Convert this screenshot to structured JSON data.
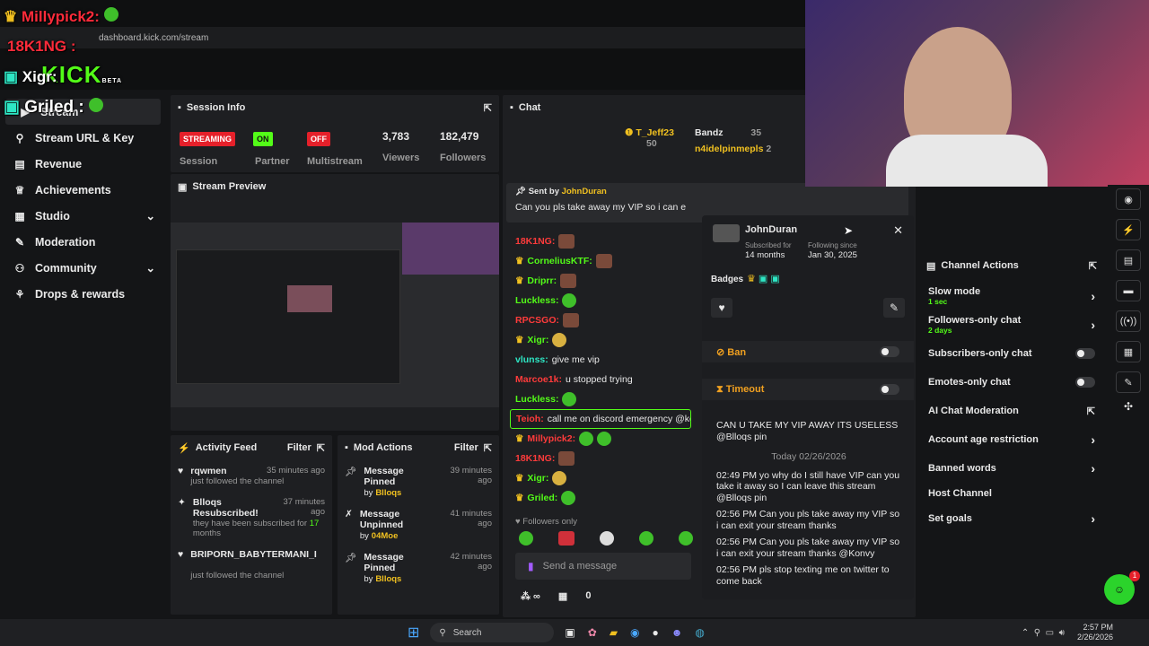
{
  "overlay": {
    "users": [
      {
        "name": "Millypick2",
        "suffix": ":"
      },
      {
        "name": "18K1NG",
        "suffix": ":"
      },
      {
        "name": "Xigr",
        "suffix": ":"
      },
      {
        "name": "Griled",
        "suffix": ":"
      }
    ],
    "logo": "KICK",
    "logo_sub": "BETA"
  },
  "browser": {
    "url": "dashboard.kick.com/stream"
  },
  "sidebar": {
    "items": [
      {
        "label": "Stream",
        "icon": "stream-icon"
      },
      {
        "label": "Stream URL & Key",
        "icon": "key-icon"
      },
      {
        "label": "Revenue",
        "icon": "revenue-icon"
      },
      {
        "label": "Achievements",
        "icon": "trophy-icon"
      },
      {
        "label": "Studio",
        "icon": "studio-icon"
      },
      {
        "label": "Moderation",
        "icon": "wrench-icon"
      },
      {
        "label": "Community",
        "icon": "community-icon"
      },
      {
        "label": "Drops & rewards",
        "icon": "gift-icon"
      }
    ]
  },
  "session": {
    "title": "Session Info",
    "streaming": "STREAMING",
    "on": "ON",
    "off": "OFF",
    "viewers": "3,783",
    "followers": "182,479",
    "labels": {
      "session": "Session",
      "partner": "Partner",
      "multistream": "Multistream",
      "viewers": "Viewers",
      "followers": "Followers"
    }
  },
  "preview": {
    "title": "Stream Preview"
  },
  "activity": {
    "title": "Activity Feed",
    "filter": "Filter",
    "items": [
      {
        "name": "rqwmen",
        "time": "35 minutes ago",
        "desc": "just followed the channel"
      },
      {
        "name": "Blloqs Resubscribed!",
        "time": "37 minutes ago",
        "desc": "they have been subscribed for",
        "months": "17",
        "months_suffix": "months"
      },
      {
        "name": "BRIPORN_BABYTERMANI_I",
        "time": "",
        "desc": "just followed the channel"
      }
    ]
  },
  "mod": {
    "title": "Mod Actions",
    "filter": "Filter",
    "items": [
      {
        "action": "Message Pinned",
        "by": "by",
        "user": "Blloqs",
        "time": "39 minutes ago"
      },
      {
        "action": "Message Unpinned",
        "by": "by",
        "user": "04Moe",
        "time": "41 minutes ago"
      },
      {
        "action": "Message Pinned",
        "by": "by",
        "user": "Blloqs",
        "time": "42 minutes ago"
      }
    ]
  },
  "chat": {
    "title": "Chat",
    "top": [
      {
        "name": "T_Jeff23",
        "count": "50"
      },
      {
        "name": "Bandz",
        "count": "35"
      },
      {
        "name": "n4idelpinmepls",
        "count": "2"
      }
    ],
    "pinned": {
      "sent_by": "Sent by",
      "user": "JohnDuran",
      "text": "Can you pls take away my VIP so i can e"
    },
    "messages": [
      {
        "user": "18K1NG:",
        "text": "",
        "color": "#ff3b3b"
      },
      {
        "user": "CorneliusKTF:",
        "text": "",
        "color": "#53fc18"
      },
      {
        "user": "Driprr:",
        "text": "",
        "color": "#53fc18"
      },
      {
        "user": "Luckless:",
        "text": "",
        "color": "#53fc18"
      },
      {
        "user": "RPCSGO:",
        "text": "",
        "color": "#ff3b3b"
      },
      {
        "user": "Xigr:",
        "text": "",
        "color": "#53fc18"
      },
      {
        "user": "vlunss:",
        "text": "give me vip",
        "color": "#2ee6c4"
      },
      {
        "user": "Marcoe1k:",
        "text": "u stopped trying",
        "color": "#ff3b3b"
      },
      {
        "user": "Luckless:",
        "text": "",
        "color": "#53fc18"
      },
      {
        "user": "Teioh:",
        "text": "call me on discord emergency @kon",
        "color": "#ff3b3b"
      },
      {
        "user": "Millypick2:",
        "text": "",
        "color": "#ff3b3b"
      },
      {
        "user": "18K1NG:",
        "text": "",
        "color": "#ff3b3b"
      },
      {
        "user": "Xigr:",
        "text": "",
        "color": "#53fc18"
      },
      {
        "user": "Griled:",
        "text": "",
        "color": "#53fc18"
      }
    ],
    "followers_only": "Followers only",
    "placeholder": "Send a message",
    "bottom_count": "0"
  },
  "user_card": {
    "name": "JohnDuran",
    "sub_label": "Subscribed for",
    "sub_value": "14 months",
    "follow_label": "Following since",
    "follow_value": "Jan 30, 2025",
    "badges_label": "Badges",
    "ban": "Ban",
    "timeout": "Timeout",
    "history": [
      {
        "text": "CAN U TAKE MY VIP AWAY ITS USELESS @Blloqs pin"
      },
      {
        "text": "Today 02/26/2026"
      },
      {
        "text": "02:49 PM yo why do I still have VIP can you take it away so I can leave this stream @Blloqs pin"
      },
      {
        "text": "02:56 PM Can you pls take away my VIP so i can exit your stream thanks"
      },
      {
        "text": "02:56 PM Can you pls take away my VIP so i can exit your stream thanks @Konvy"
      },
      {
        "text": "02:56 PM pls stop texting me on twitter to come back"
      }
    ]
  },
  "channel_actions": {
    "title": "Channel Actions",
    "items": [
      {
        "label": "Slow mode",
        "sub": "1 sec",
        "type": "chev"
      },
      {
        "label": "Followers-only chat",
        "sub": "2 days",
        "type": "chev"
      },
      {
        "label": "Subscribers-only chat",
        "sub": "",
        "type": "toggle"
      },
      {
        "label": "Emotes-only chat",
        "sub": "",
        "type": "toggle"
      },
      {
        "label": "AI Chat Moderation",
        "sub": "",
        "type": "ext"
      },
      {
        "label": "Account age restriction",
        "sub": "",
        "type": "chev"
      },
      {
        "label": "Banned words",
        "sub": "",
        "type": "chev"
      },
      {
        "label": "Host Channel",
        "sub": "",
        "type": "none"
      },
      {
        "label": "Set goals",
        "sub": "",
        "type": "chev"
      }
    ]
  },
  "taskbar": {
    "search": "Search",
    "time": "2:57 PM",
    "date": "2/26/2026",
    "notif": "1"
  }
}
